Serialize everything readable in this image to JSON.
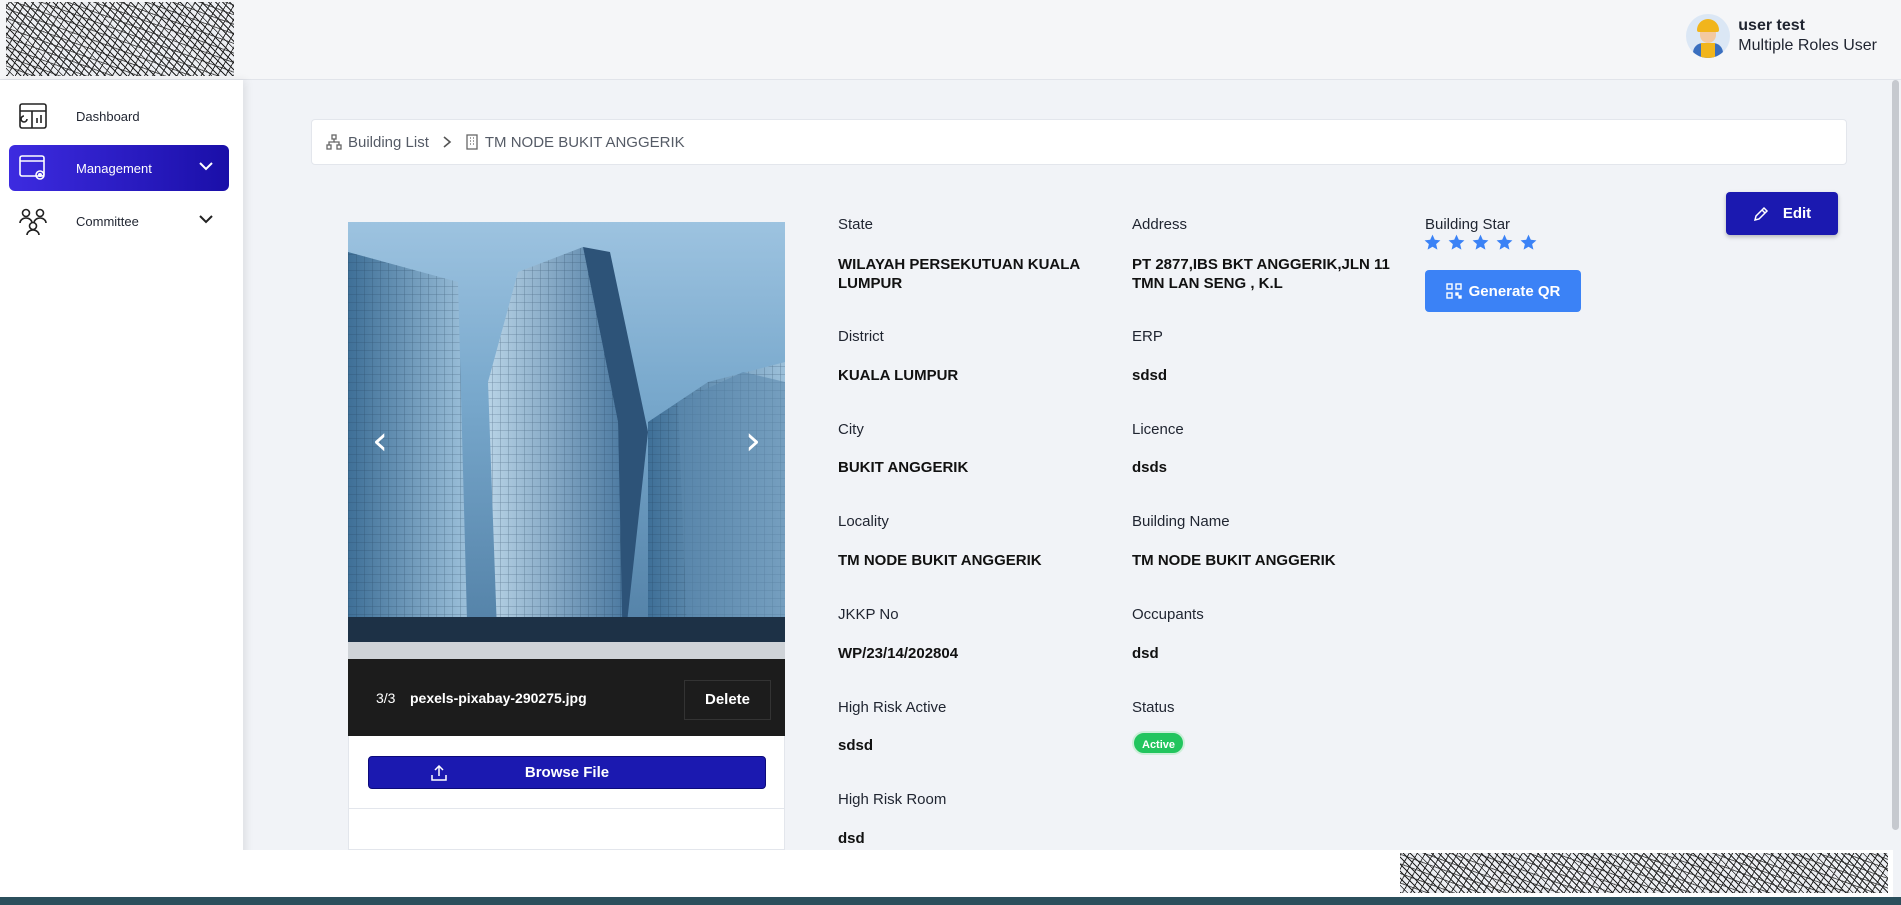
{
  "header": {
    "user_name": "user test",
    "user_role": "Multiple Roles User"
  },
  "sidebar": {
    "items": [
      {
        "label": "Dashboard",
        "icon": "dashboard-icon"
      },
      {
        "label": "Management",
        "icon": "management-icon",
        "active": true
      },
      {
        "label": "Committee",
        "icon": "committee-icon"
      }
    ]
  },
  "breadcrumb": {
    "parent": "Building List",
    "current": "TM NODE BUKIT ANGGERIK"
  },
  "gallery": {
    "counter": "3/3",
    "filename": "pexels-pixabay-290275.jpg",
    "delete_label": "Delete",
    "browse_label": "Browse File",
    "prev_glyph": "‹",
    "next_glyph": "›"
  },
  "details": {
    "state_label": "State",
    "state_value": "WILAYAH PERSEKUTUAN KUALA LUMPUR",
    "address_label": "Address",
    "address_value": "PT 2877,IBS BKT ANGGERIK,JLN 11 TMN LAN SENG , K.L",
    "district_label": "District",
    "district_value": "KUALA LUMPUR",
    "erp_label": "ERP",
    "erp_value": "sdsd",
    "city_label": "City",
    "city_value": "BUKIT ANGGERIK",
    "licence_label": "Licence",
    "licence_value": "dsds",
    "locality_label": "Locality",
    "locality_value": "TM NODE BUKIT ANGGERIK",
    "building_name_label": "Building Name",
    "building_name_value": "TM NODE BUKIT ANGGERIK",
    "jkkp_label": "JKKP No",
    "jkkp_value": "WP/23/14/202804",
    "occupants_label": "Occupants",
    "occupants_value": "dsd",
    "high_risk_active_label": "High Risk Active",
    "high_risk_active_value": "sdsd",
    "status_label": "Status",
    "status_value": "Active",
    "high_risk_room_label": "High Risk Room",
    "high_risk_room_value": "dsd"
  },
  "building_star": {
    "label": "Building Star",
    "rating": 5,
    "max": 5,
    "color": "#3b82f6"
  },
  "actions": {
    "generate_qr_label": "Generate QR",
    "edit_label": "Edit"
  },
  "colors": {
    "primary": "#1b19b0",
    "accent": "#3b82f6",
    "status_active": "#22c55e"
  }
}
